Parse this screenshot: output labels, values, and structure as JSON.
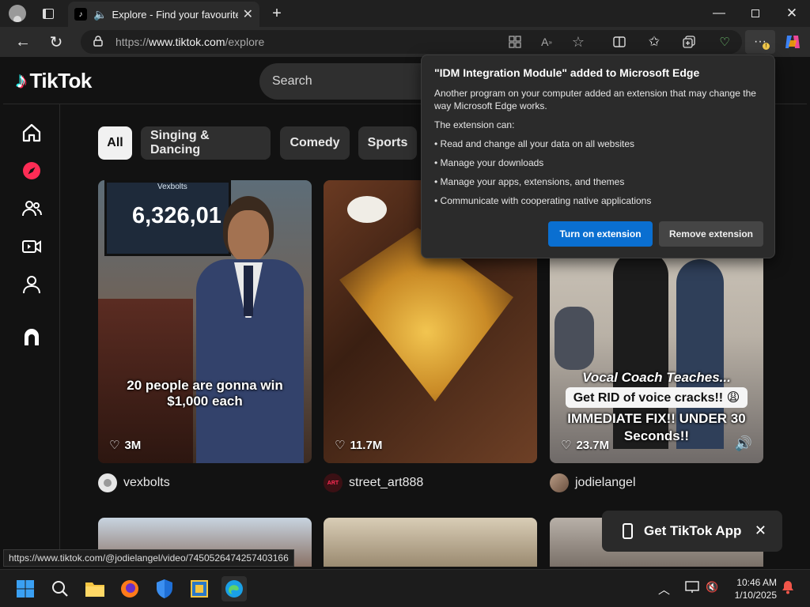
{
  "browser": {
    "tab_title": "Explore - Find your favourite",
    "url_protocol": "https://",
    "url_host": "www.tiktok.com",
    "url_path": "/explore",
    "icons": [
      "profile-icon",
      "workspaces-icon",
      "mute-icon",
      "close-tab-icon",
      "new-tab-icon",
      "minimize-icon",
      "restore-icon",
      "close-window-icon",
      "back-icon",
      "refresh-icon",
      "lock-icon",
      "app-icon",
      "read-aloud-icon",
      "favorite-icon",
      "split-screen-icon",
      "favorites-icon",
      "collections-icon",
      "browser-essentials-icon",
      "more-icon",
      "copilot-icon"
    ]
  },
  "tiktok": {
    "logo_text": "TikTok",
    "search_placeholder": "Search",
    "sidebar": [
      "home-icon",
      "explore-icon",
      "following-icon",
      "live-icon",
      "profile-icon",
      "more-icon"
    ],
    "categories": [
      "All",
      "Singing & Dancing",
      "Comedy",
      "Sports"
    ],
    "videos": [
      {
        "caption": "20 people are gonna win\n$1,000 each",
        "overlay": "6,326,01",
        "overlay_top": "Vexbolts",
        "likes": "3M",
        "author": "vexbolts"
      },
      {
        "caption": "",
        "likes": "11.7M",
        "author": "street_art888",
        "avatar_text": "ART"
      },
      {
        "caption_line1": "Vocal Coach Teaches...",
        "caption_line2": "Get RID of voice cracks!! 😩",
        "caption_line3": "IMMEDIATE FIX!! UNDER 30",
        "caption_line4": "Seconds!!",
        "likes": "23.7M",
        "author": "jodielangel"
      }
    ],
    "get_app": "Get TikTok App"
  },
  "extension_popup": {
    "title": "\"IDM Integration Module\" added to Microsoft Edge",
    "body": "Another program on your computer added an extension that may change the way Microsoft Edge works.",
    "can_label": "The extension can:",
    "permissions": [
      "• Read and change all your data on all websites",
      "• Manage your downloads",
      "• Manage your apps, extensions, and themes",
      "• Communicate with cooperating native applications"
    ],
    "primary_button": "Turn on extension",
    "secondary_button": "Remove extension"
  },
  "status_url": "https://www.tiktok.com/@jodielangel/video/7450526474257403166",
  "taskbar": {
    "time": "10:46 AM",
    "date": "1/10/2025"
  },
  "colors": {
    "edge_blue": "#0a6fd1",
    "tiktok_red": "#fe2c55",
    "tiktok_cyan": "#25f4ee"
  }
}
